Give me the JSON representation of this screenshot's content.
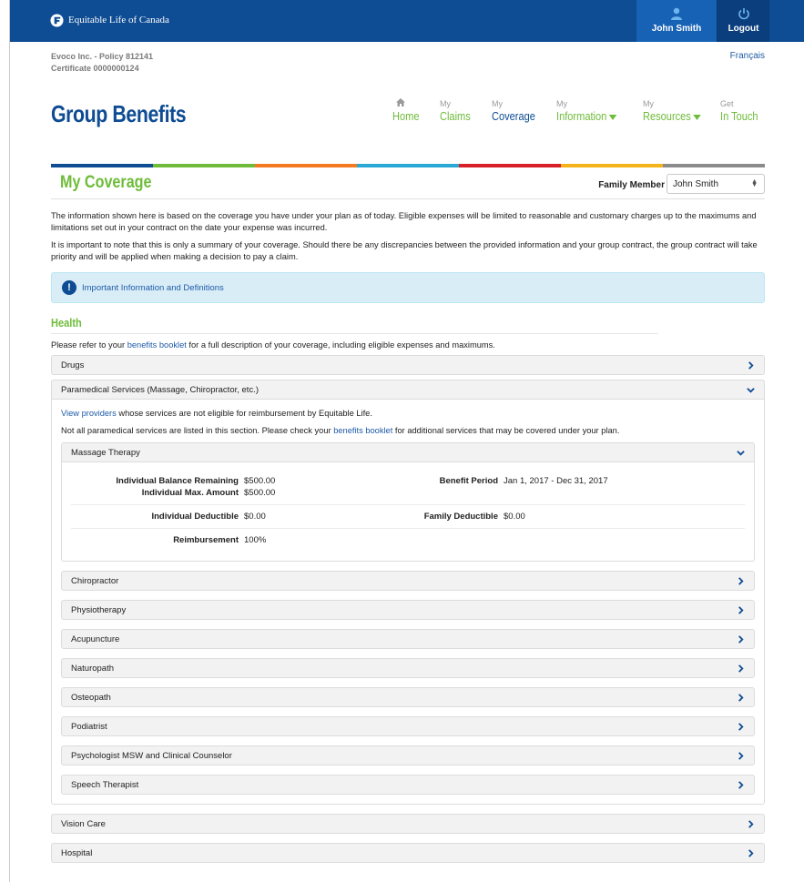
{
  "topbar": {
    "logo_text": "Equitable Life of Canada",
    "user_name": "John Smith",
    "logout_label": "Logout"
  },
  "header": {
    "policy_line": "Evoco Inc. - Policy 812141",
    "certificate_line": "Certificate 0000000124",
    "language_link": "Français",
    "brand_title": "Group Benefits"
  },
  "nav": [
    {
      "top": "",
      "bottom": "Home"
    },
    {
      "top": "My",
      "bottom": "Claims"
    },
    {
      "top": "My",
      "bottom": "Coverage"
    },
    {
      "top": "My",
      "bottom": "Information"
    },
    {
      "top": "My",
      "bottom": "Resources"
    },
    {
      "top": "Get",
      "bottom": "In Touch"
    }
  ],
  "colors": {
    "strip": [
      "#0e4c93",
      "#6ebc3a",
      "#f47a20",
      "#29a9d6",
      "#d81f26",
      "#f5b31a",
      "#8b8b8b"
    ],
    "brand_blue": "#0e4c93",
    "accent_green": "#6ebc3a"
  },
  "page": {
    "title": "My Coverage",
    "family_member_label": "Family Member",
    "family_member_value": "John Smith",
    "intro_1": "The information shown here is based on the coverage you have under your plan as of today. Eligible expenses will be limited to reasonable and customary charges up to the maximums and limitations set out in your contract on the date your expense was incurred.",
    "intro_2": "It is important to note that this is only a summary of your coverage. Should there be any discrepancies between the provided information and your group contract, the group contract will take priority and will be applied when making a decision to pay a claim.",
    "alert_text": "Important Information and Definitions"
  },
  "health": {
    "title": "Health",
    "refer_pre": "Please refer to your ",
    "refer_link": "benefits booklet",
    "refer_post": " for a full description of your coverage, including eligible expenses and maximums.",
    "drugs": "Drugs",
    "paramedical": "Paramedical Services (Massage, Chiropractor, etc.)",
    "view_providers_link": "View providers",
    "view_providers_post": " whose services are not eligible for reimbursement by Equitable Life.",
    "not_all_pre": "Not all paramedical services are listed in this section. Please check your ",
    "not_all_link": "benefits booklet",
    "not_all_post": " for additional services that may be covered under your plan.",
    "massage": {
      "title": "Massage Therapy",
      "balance_label": "Individual Balance Remaining",
      "balance_value": "$500.00",
      "max_label": "Individual Max. Amount",
      "max_value": "$500.00",
      "period_label": "Benefit Period",
      "period_value": "Jan 1, 2017 - Dec 31, 2017",
      "ind_deductible_label": "Individual Deductible",
      "ind_deductible_value": "$0.00",
      "fam_deductible_label": "Family Deductible",
      "fam_deductible_value": "$0.00",
      "reimbursement_label": "Reimbursement",
      "reimbursement_value": "100%"
    },
    "services": [
      "Chiropractor",
      "Physiotherapy",
      "Acupuncture",
      "Naturopath",
      "Osteopath",
      "Podiatrist",
      "Psychologist MSW and Clinical Counselor",
      "Speech Therapist"
    ],
    "vision": "Vision Care",
    "hospital": "Hospital"
  }
}
